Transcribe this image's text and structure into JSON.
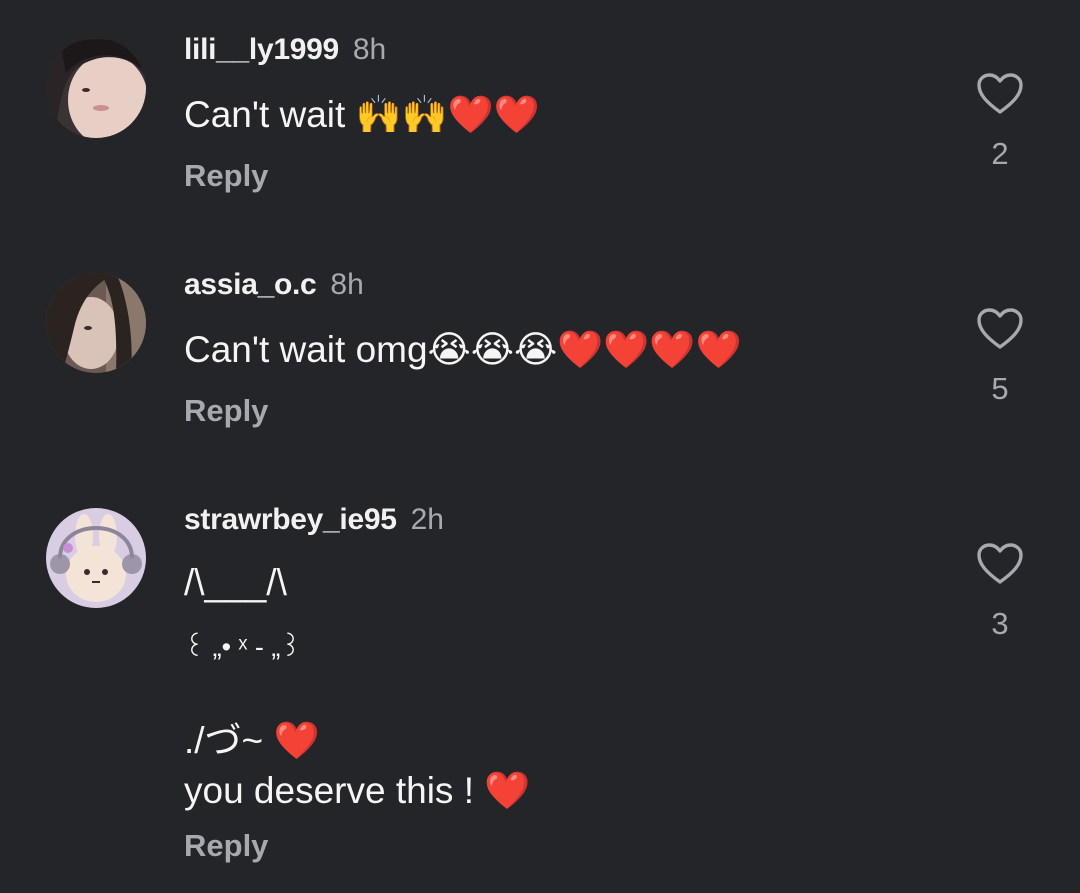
{
  "comments": [
    {
      "username": "lili__ly1999",
      "time": "8h",
      "lines": [
        "Can't wait 🙌🙌❤️❤️"
      ],
      "reply_label": "Reply",
      "likes": "2",
      "avatar_icon": "avatar-photo"
    },
    {
      "username": "assia_o.c",
      "time": "8h",
      "lines": [
        "Can't wait omg😭😭😭❤️❤️❤️❤️"
      ],
      "reply_label": "Reply",
      "likes": "5",
      "avatar_icon": "avatar-photo"
    },
    {
      "username": "strawrbey_ie95",
      "time": "2h",
      "lines": [
        "/\\___/\\",
        "꒰ „• ˣ - „꒱",
        "",
        "./づ~ ❤️",
        "you deserve this ! ❤️"
      ],
      "reply_label": "Reply",
      "likes": "3",
      "avatar_icon": "avatar-bunny"
    }
  ],
  "colors": {
    "background": "#242529",
    "text": "#f1f1f1",
    "muted": "#a8a9ae"
  },
  "icons": {
    "like": "heart-outline-icon"
  }
}
